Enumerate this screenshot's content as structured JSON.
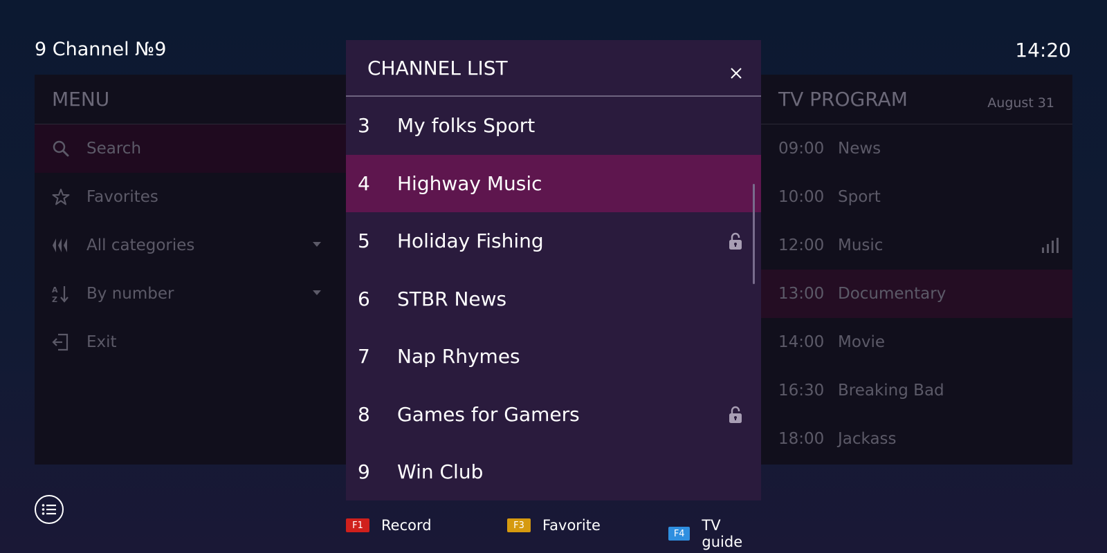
{
  "header": {
    "channel_title": "9 Channel №9",
    "clock": "14:20"
  },
  "menu": {
    "title": "MENU",
    "items": [
      {
        "label": "Search",
        "icon": "search-icon",
        "active": true
      },
      {
        "label": "Favorites",
        "icon": "star-icon"
      },
      {
        "label": "All categories",
        "icon": "categories-icon",
        "dropdown": true
      },
      {
        "label": "By number",
        "icon": "sort-az-icon",
        "dropdown": true
      },
      {
        "label": "Exit",
        "icon": "exit-icon"
      }
    ]
  },
  "program": {
    "title": "TV PROGRAM",
    "date": "August 31",
    "rows": [
      {
        "time": "09:00",
        "name": "News"
      },
      {
        "time": "10:00",
        "name": "Sport"
      },
      {
        "time": "12:00",
        "name": "Music",
        "icon": "signal-bars-icon"
      },
      {
        "time": "13:00",
        "name": "Documentary",
        "active": true
      },
      {
        "time": "14:00",
        "name": "Movie"
      },
      {
        "time": "16:30",
        "name": "Breaking Bad"
      },
      {
        "time": "18:00",
        "name": "Jackass"
      }
    ]
  },
  "channel_list": {
    "title": "CHANNEL LIST",
    "items": [
      {
        "number": "3",
        "name": "My folks Sport"
      },
      {
        "number": "4",
        "name": "Highway Music",
        "active": true
      },
      {
        "number": "5",
        "name": "Holiday Fishing",
        "locked": true
      },
      {
        "number": "6",
        "name": "STBR News"
      },
      {
        "number": "7",
        "name": "Nap Rhymes"
      },
      {
        "number": "8",
        "name": "Games for Gamers",
        "locked": true
      },
      {
        "number": "9",
        "name": "Win Club"
      }
    ]
  },
  "function_keys": [
    {
      "key": "F1",
      "label": "Record",
      "color": "#d0201c"
    },
    {
      "key": "F3",
      "label": "Favorite",
      "color": "#d69a0f"
    },
    {
      "key": "F4",
      "label": "TV guide",
      "color": "#2f8fe0"
    }
  ],
  "colors": {
    "accent": "#5e164e",
    "modal_bg": "#2a1b3d",
    "panel_bg": "#110f1c"
  }
}
